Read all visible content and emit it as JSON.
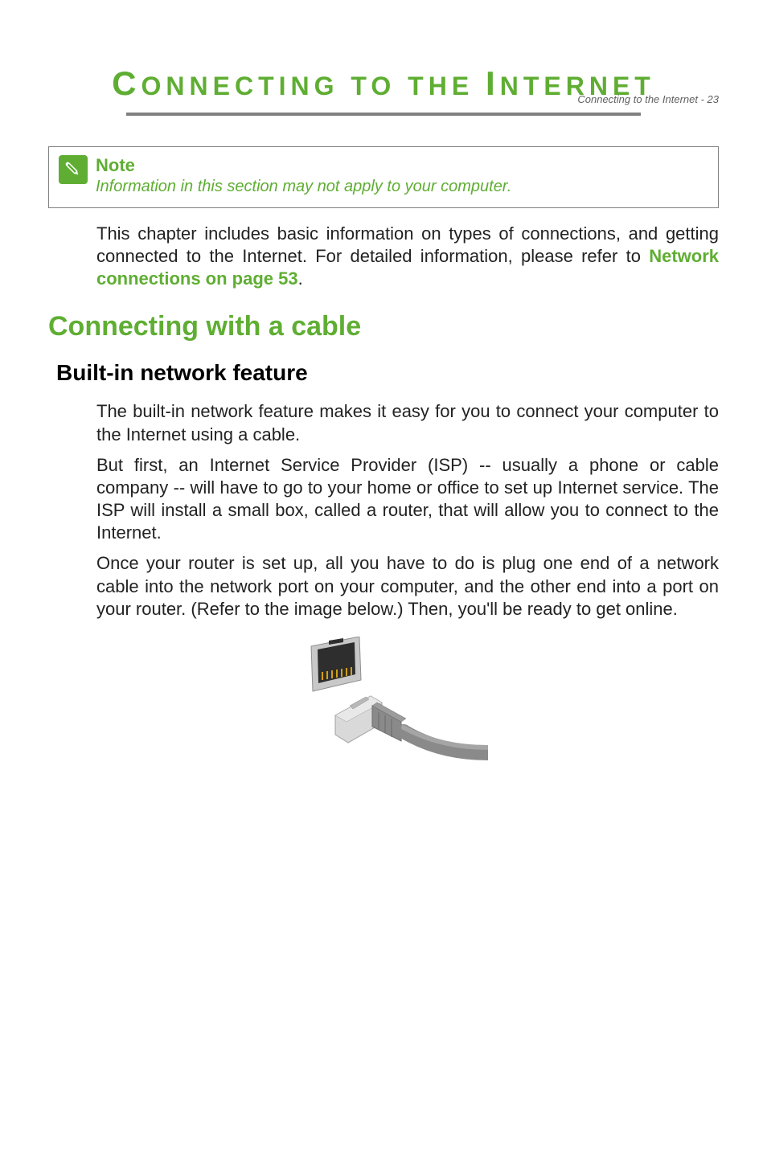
{
  "header": {
    "running_head": "Connecting to the Internet - 23"
  },
  "title": {
    "part1_cap": "C",
    "part1_rest": "ONNECTING",
    "part2": " TO THE ",
    "part3_cap": "I",
    "part3_rest": "NTERNET"
  },
  "note": {
    "label": "Note",
    "body": "Information in this section may not apply to your computer."
  },
  "intro": {
    "text_before_link": "This chapter includes basic information on types of connections, and getting connected to the Internet. For detailed information, please refer to ",
    "link_text": "Network connections on page 53",
    "text_after_link": "."
  },
  "h1": "Connecting with a cable",
  "h2": "Built-in network feature",
  "paragraphs": {
    "p1": "The built-in network feature makes it easy for you to connect your computer to the Internet using a cable.",
    "p2": "But first, an Internet Service Provider (ISP) -- usually a phone or cable company -- will have to go to your home or office to set up Internet service. The ISP will install a small box, called a router, that will allow you to connect to the Internet.",
    "p3": "Once your router is set up, all you have to do is plug one end of a network cable into the network port on your computer, and the other end into a port on your router. (Refer to the image below.) Then, you'll be ready to get online."
  },
  "illustration": {
    "alt": "Ethernet port and network cable plug illustration"
  }
}
